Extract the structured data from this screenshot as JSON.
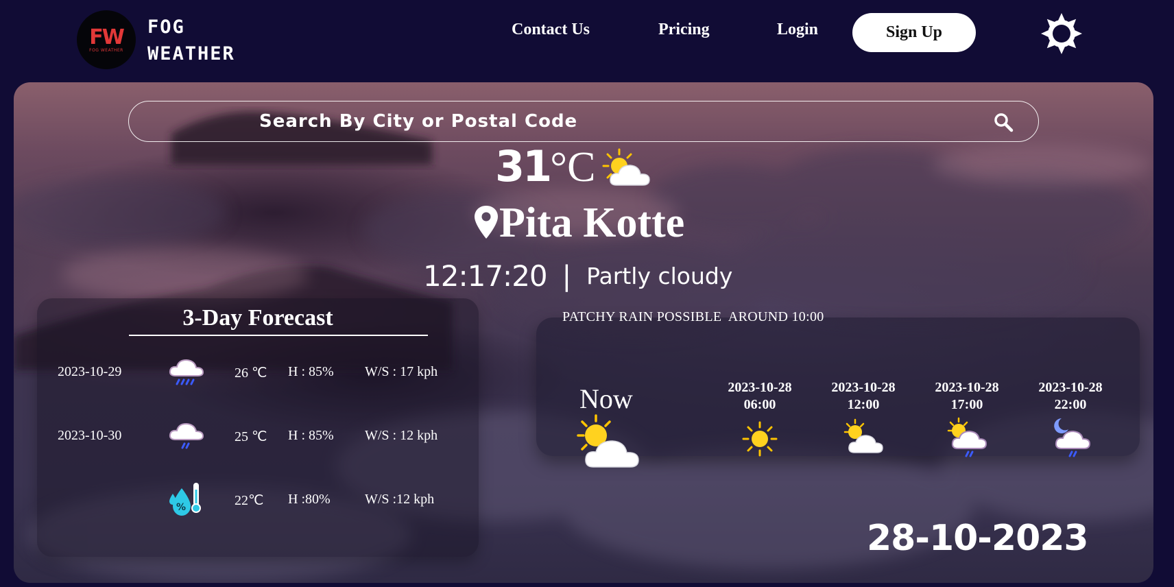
{
  "header": {
    "logo_mark": "FW",
    "logo_small": "FOG WEATHER",
    "brand_line1": "FOG",
    "brand_line2": "WEATHER",
    "nav": [
      "Contact Us",
      "Pricing",
      "Login"
    ],
    "signup_label": "Sign Up",
    "theme_icon": "sun-icon"
  },
  "search": {
    "placeholder": "Search By City or Postal Code",
    "icon": "search-icon"
  },
  "current": {
    "temp_value": "31",
    "temp_unit": "°C",
    "icon": "partly-cloudy-icon",
    "city": "Pita Kotte",
    "time": "12:17:20",
    "separator": "|",
    "condition": "Partly cloudy"
  },
  "forecast": {
    "title": "3-Day Forecast",
    "rows": [
      {
        "date": "2023-10-29",
        "icon": "rain-cloud-icon",
        "temp": "26 ℃",
        "humidity": "H : 85%",
        "wind": "W/S : 17 kph"
      },
      {
        "date": "2023-10-30",
        "icon": "light-rain-cloud-icon",
        "temp": "25 ℃",
        "humidity": "H : 85%",
        "wind": "W/S : 12 kph"
      },
      {
        "date": "",
        "icon": "humidity-thermometer-icon",
        "temp": "22℃",
        "humidity": "H :80%",
        "wind": "W/S :12 kph"
      }
    ]
  },
  "hourly": {
    "alert": "PATCHY RAIN POSSIBLE  AROUND 10:00",
    "now_label": "Now",
    "now_icon": "partly-cloudy-icon",
    "slots": [
      {
        "date": "2023-10-28",
        "time": "06:00",
        "icon": "sun-icon"
      },
      {
        "date": "2023-10-28",
        "time": "12:00",
        "icon": "partly-cloudy-icon"
      },
      {
        "date": "2023-10-28",
        "time": "17:00",
        "icon": "sun-cloud-rain-icon"
      },
      {
        "date": "2023-10-28",
        "time": "22:00",
        "icon": "moon-cloud-rain-icon"
      }
    ]
  },
  "date_display": "28-10-2023",
  "colors": {
    "background": "#110c35",
    "accent_red": "#e23838",
    "rain_blue": "#3b5bff",
    "sun_yellow": "#ffd21f"
  }
}
